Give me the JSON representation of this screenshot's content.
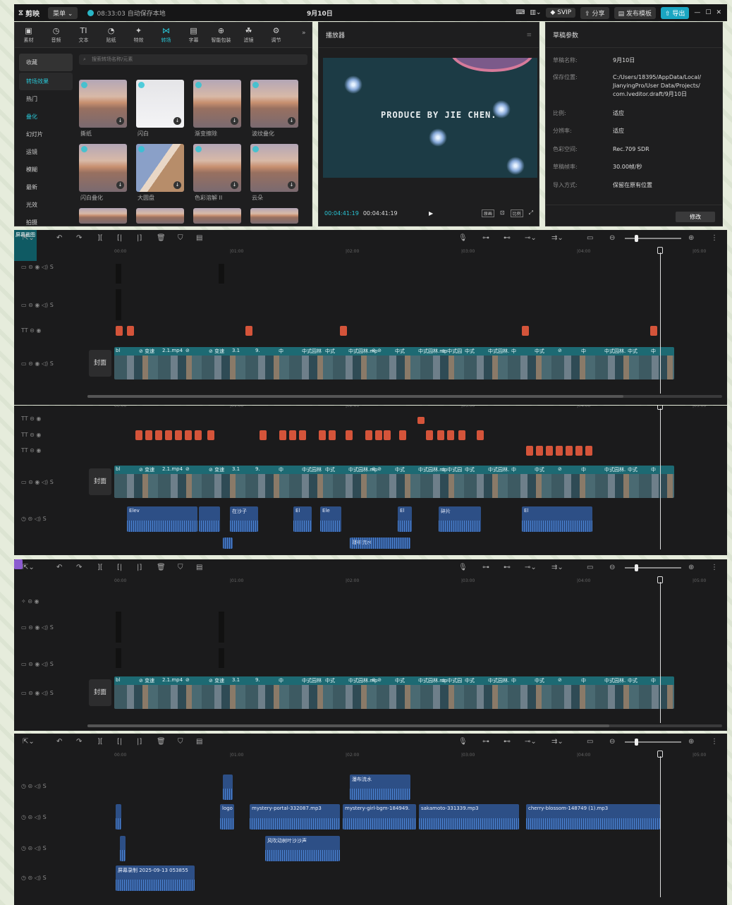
{
  "topbar": {
    "logo": "剪映",
    "menu": "菜单",
    "saved": "08:33:03 自动保存本地",
    "title": "9月10日",
    "svip": "SVIP",
    "share": "分享",
    "publish": "发布模板",
    "export": "导出"
  },
  "tools": [
    {
      "label": "素材",
      "icon": "▣"
    },
    {
      "label": "音频",
      "icon": "◷"
    },
    {
      "label": "文本",
      "icon": "TI"
    },
    {
      "label": "贴纸",
      "icon": "◔"
    },
    {
      "label": "特效",
      "icon": "✦"
    },
    {
      "label": "转场",
      "icon": "⋈"
    },
    {
      "label": "字幕",
      "icon": "▤"
    },
    {
      "label": "智能包装",
      "icon": "⊕"
    },
    {
      "label": "滤镜",
      "icon": "☘"
    },
    {
      "label": "调节",
      "icon": "⚙"
    }
  ],
  "categories": [
    "收藏",
    "转场效果",
    "热门",
    "叠化",
    "幻灯片",
    "运镜",
    "模糊",
    "最新",
    "光效",
    "拍摄"
  ],
  "search_placeholder": "搜索转场名称/元素",
  "thumbs": [
    "撕纸",
    "闪白",
    "渐变擦除",
    "波纹叠化",
    "闪白叠化",
    "大圆盘",
    "色彩溶解 II",
    "云朵"
  ],
  "player": {
    "title": "播放器",
    "watermark": "PRODUCE BY JIE CHEN.",
    "time_current": "00:04:41:19",
    "time_total": "00:04:41:19",
    "btn_original": "原画",
    "btn_ratio": "比例"
  },
  "params": {
    "title": "草稿参数",
    "rows": [
      {
        "k": "草稿名称:",
        "v": "9月10日"
      },
      {
        "k": "保存位置:",
        "v": "C:/Users/18395/AppData/Local/ JianyingPro/User Data/Projects/ com.lveditor.draft/9月10日"
      },
      {
        "k": "比例:",
        "v": "适应"
      },
      {
        "k": "分辨率:",
        "v": "适应"
      },
      {
        "k": "色彩空间:",
        "v": "Rec.709 SDR"
      },
      {
        "k": "草稿帧率:",
        "v": "30.00帧/秒"
      },
      {
        "k": "导入方式:",
        "v": "保留在原有位置"
      }
    ],
    "modify": "修改"
  },
  "ruler": [
    "00:00",
    "|01:00",
    "|02:00",
    "|03:00",
    "|04:00",
    "|05:00"
  ],
  "cover": "封面",
  "clip_labels": [
    "bl",
    "⊘ 变速",
    "2.1.mp4",
    "⊘",
    "⊘ 变速",
    "3.1",
    "9.",
    "中",
    "中式园林",
    "中式",
    "中式园林.mp",
    "⊘ ⊘",
    "中式",
    "中式园林.mp",
    "⊘ 中式园",
    "中式",
    "中式园林.",
    "中",
    "中式",
    "⊘",
    "中",
    "中式园林.",
    "中式",
    "中"
  ],
  "text_clips": {
    "screen": "屏幕截图"
  },
  "audio_clips": [
    "mystery-portal-332087.mp3",
    "mystery-girl-bgm-184949.",
    "sakamoto-331339.mp3",
    "cherry-blossom-148749 (1).mp3",
    "风吹动树叶沙沙声",
    "屏幕录制 2025-09-13 053855",
    "瀑布流水",
    "logo",
    "在沙子",
    "Elev",
    "Ele",
    "El",
    "Ele",
    "El",
    "El",
    "碎片"
  ]
}
